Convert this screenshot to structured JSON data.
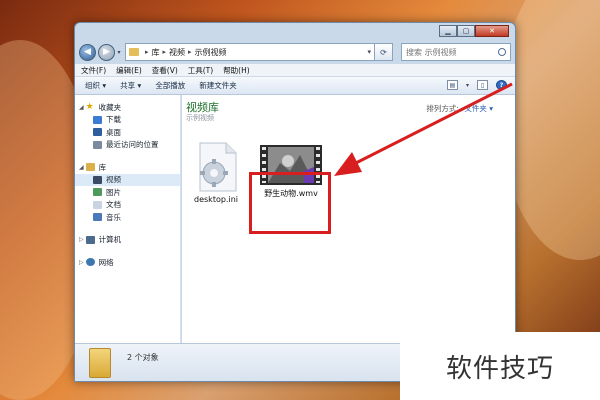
{
  "address": {
    "crumbs": [
      "库",
      "视频",
      "示例视频"
    ],
    "search_placeholder": "搜索 示例视频"
  },
  "menu": [
    "文件(F)",
    "编辑(E)",
    "查看(V)",
    "工具(T)",
    "帮助(H)"
  ],
  "toolbar": {
    "organize": "组织 ▾",
    "share": "共享 ▾",
    "play_all": "全部播放",
    "new_folder": "新建文件夹"
  },
  "sidebar": {
    "favorites": "收藏夹",
    "favorites_items": [
      "下载",
      "桌面",
      "最近访问的位置"
    ],
    "libraries": "库",
    "library_items": [
      "视频",
      "图片",
      "文档",
      "音乐"
    ],
    "computer": "计算机",
    "network": "网络"
  },
  "content": {
    "title": "视频库",
    "subtitle": "示例视频",
    "arrange_label": "排列方式:",
    "arrange_value": "文件夹 ▾",
    "files": [
      {
        "name": "desktop.ini",
        "icon": "settings-file-icon"
      },
      {
        "name": "野生动物.wmv",
        "icon": "video-thumbnail-icon"
      }
    ]
  },
  "status": {
    "count_text": "2 个对象"
  },
  "watermark": "软件技巧",
  "colors": {
    "highlight_box": "#d81e1e",
    "arrow": "#d81e1e",
    "library_title": "#1d6f2b"
  }
}
